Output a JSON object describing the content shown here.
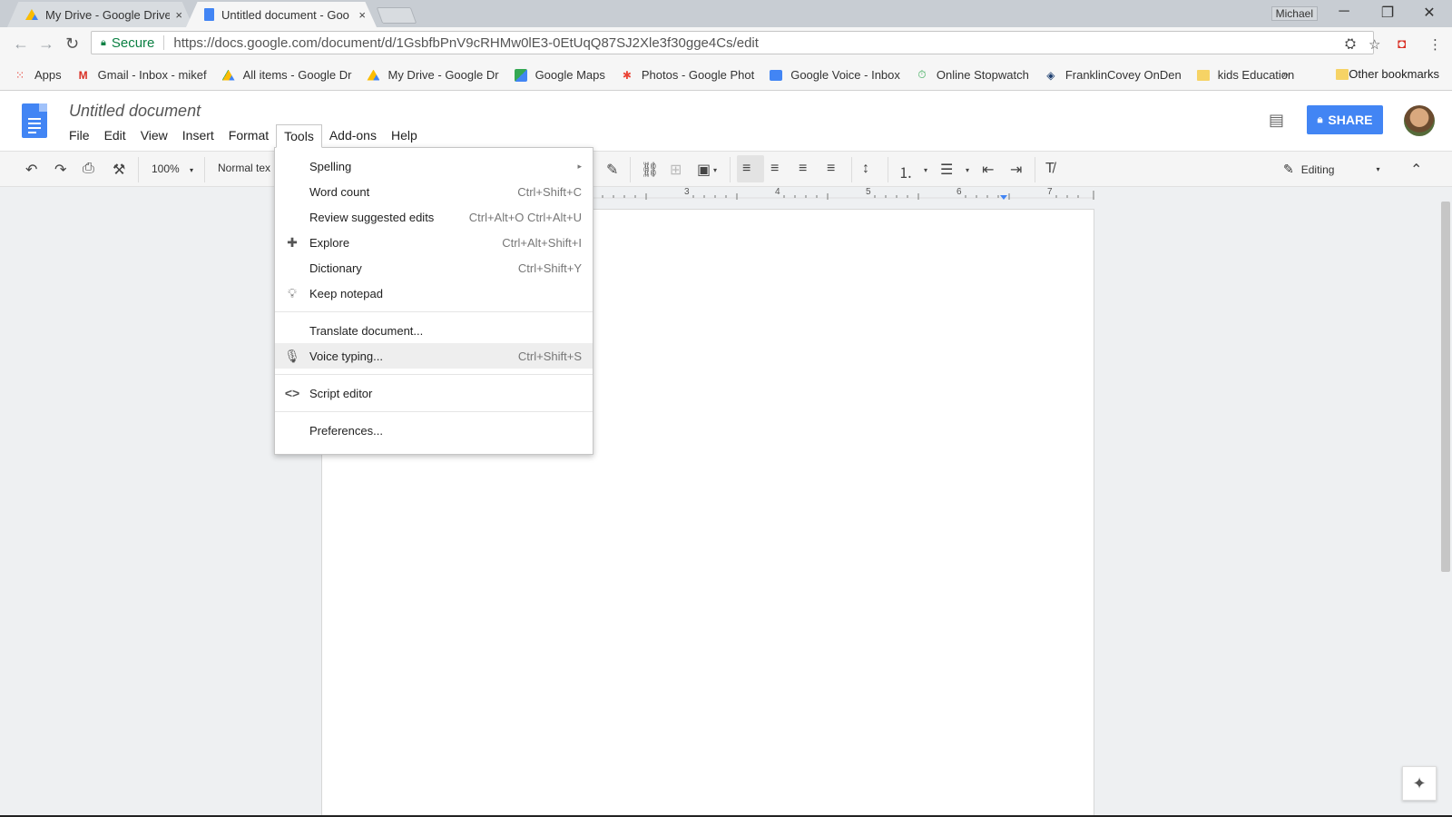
{
  "browser": {
    "tabs": [
      {
        "title": "My Drive - Google Drive",
        "icon": "google-drive-icon",
        "close": "×"
      },
      {
        "title": "Untitled document - Goo",
        "icon": "google-docs-icon",
        "close": "×"
      }
    ],
    "profile": "Michael",
    "window_controls": {
      "minimize": "─",
      "restore": "❐",
      "close": "✕"
    },
    "security_label": "Secure",
    "url": "https://docs.google.com/document/d/1GsbfbPnV9cRHMw0lE3-0EtUqQ87SJ2Xle3f30gge4Cs/edit"
  },
  "bookmarks": {
    "items": [
      {
        "label": "Apps",
        "icon": "apps-grid-icon",
        "color": "#e8453c"
      },
      {
        "label": "Gmail - Inbox - mikef",
        "icon": "gmail-icon",
        "color": "#d93025"
      },
      {
        "label": "All items - Google Dr",
        "icon": "google-drive-icon",
        "color": "#fbbc04"
      },
      {
        "label": "My Drive - Google Dr",
        "icon": "google-drive-icon",
        "color": "#fbbc04"
      },
      {
        "label": "Google Maps",
        "icon": "google-maps-icon",
        "color": "#34a853"
      },
      {
        "label": "Photos - Google Phot",
        "icon": "google-photos-icon",
        "color": "#ea4335"
      },
      {
        "label": "Google Voice - Inbox",
        "icon": "google-voice-icon",
        "color": "#4285f4"
      },
      {
        "label": "Online Stopwatch",
        "icon": "stopwatch-icon",
        "color": "#34a853"
      },
      {
        "label": "FranklinCovey OnDen",
        "icon": "franklincovey-icon",
        "color": "#1a3c6e"
      },
      {
        "label": "kids Education",
        "icon": "folder-icon",
        "color": "#f6d365"
      }
    ],
    "overflow": "»",
    "other": "Other bookmarks"
  },
  "docs": {
    "title": "Untitled document",
    "menu": [
      "File",
      "Edit",
      "View",
      "Insert",
      "Format",
      "Tools",
      "Add-ons",
      "Help"
    ],
    "share_label": "SHARE",
    "zoom": "100%",
    "style": "Normal tex",
    "mode": "Editing",
    "ruler_numbers": [
      "3",
      "4",
      "5",
      "6",
      "7"
    ]
  },
  "tools_menu": {
    "items": [
      {
        "label": "Spelling",
        "shortcut": "",
        "icon": "",
        "submenu": "▸"
      },
      {
        "label": "Word count",
        "shortcut": "Ctrl+Shift+C",
        "icon": ""
      },
      {
        "label": "Review suggested edits",
        "shortcut": "Ctrl+Alt+O Ctrl+Alt+U",
        "icon": ""
      },
      {
        "label": "Explore",
        "shortcut": "Ctrl+Alt+Shift+I",
        "icon": "explore-icon"
      },
      {
        "label": "Dictionary",
        "shortcut": "Ctrl+Shift+Y",
        "icon": ""
      },
      {
        "label": "Keep notepad",
        "shortcut": "",
        "icon": "lightbulb-icon"
      },
      {
        "label": "Translate document...",
        "shortcut": "",
        "icon": ""
      },
      {
        "label": "Voice typing...",
        "shortcut": "Ctrl+Shift+S",
        "icon": "microphone-icon",
        "highlighted": true
      },
      {
        "label": "Script editor",
        "shortcut": "",
        "icon": "code-icon"
      },
      {
        "label": "Preferences...",
        "shortcut": "",
        "icon": ""
      }
    ]
  }
}
